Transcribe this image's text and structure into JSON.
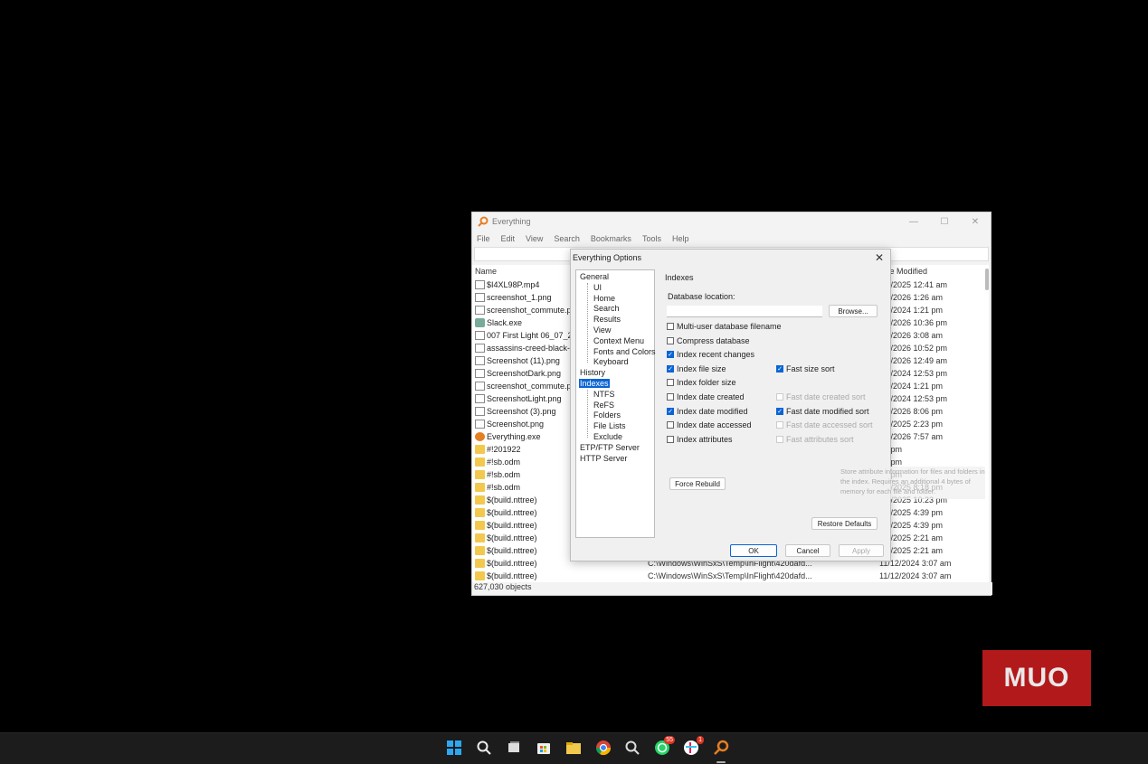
{
  "window": {
    "title": "Everything",
    "menu": [
      "File",
      "Edit",
      "View",
      "Search",
      "Bookmarks",
      "Tools",
      "Help"
    ],
    "columns": {
      "name": "Name",
      "date_modified": "te Modified"
    },
    "rows": [
      {
        "name": "$I4XL98P.mp4",
        "path": "",
        "date": "/02/2025 12:41 am",
        "icon": "file"
      },
      {
        "name": "screenshot_1.png",
        "path": "",
        "date": "/08/2026 1:26 am",
        "icon": "file"
      },
      {
        "name": "screenshot_commute.pn",
        "path": "",
        "date": "/04/2024 1:21 pm",
        "icon": "file"
      },
      {
        "name": "Slack.exe",
        "path": "",
        "date": "/07/2026 10:36 pm",
        "icon": "exe"
      },
      {
        "name": "007 First Light 06_07_202",
        "path": "",
        "date": "/07/2026 3:08 am",
        "icon": "file"
      },
      {
        "name": "assassins-creed-black-fl",
        "path": "",
        "date": "/03/2026 10:52 pm",
        "icon": "file"
      },
      {
        "name": "Screenshot (11).png",
        "path": "",
        "date": "/04/2026 12:49 am",
        "icon": "file"
      },
      {
        "name": "ScreenshotDark.png",
        "path": "",
        "date": "/10/2024 12:53 pm",
        "icon": "file"
      },
      {
        "name": "screenshot_commute.pn",
        "path": "",
        "date": "/04/2024 1:21 pm",
        "icon": "file"
      },
      {
        "name": "ScreenshotLight.png",
        "path": "",
        "date": "/10/2024 12:53 pm",
        "icon": "file"
      },
      {
        "name": "Screenshot (3).png",
        "path": "",
        "date": "/02/2026 8:06 pm",
        "icon": "file"
      },
      {
        "name": "Screenshot.png",
        "path": "",
        "date": "/05/2025 2:23 pm",
        "icon": "file"
      },
      {
        "name": "Everything.exe",
        "path": "",
        "date": "/01/2026 7:57 am",
        "icon": "ev"
      },
      {
        "name": "#!201922",
        "path": "",
        "date": "33 pm",
        "icon": "folder"
      },
      {
        "name": "#!sb.odm",
        "path": "",
        "date": "22 pm",
        "icon": "folder"
      },
      {
        "name": "#!sb.odm",
        "path": "",
        "date": "37 pm",
        "icon": "folder"
      },
      {
        "name": "#!sb.odm",
        "path": "",
        "date": "/05/2025 8:18 pm",
        "icon": "folder"
      },
      {
        "name": "$(build.nttree)",
        "path": "",
        "date": "/12/2025 10:23 pm",
        "icon": "folder"
      },
      {
        "name": "$(build.nttree)",
        "path": "",
        "date": "/06/2025 4:39 pm",
        "icon": "folder"
      },
      {
        "name": "$(build.nttree)",
        "path": "",
        "date": "/06/2025 4:39 pm",
        "icon": "folder"
      },
      {
        "name": "$(build.nttree)",
        "path": "",
        "date": "/05/2025 2:21 am",
        "icon": "folder"
      },
      {
        "name": "$(build.nttree)",
        "path": "",
        "date": "/05/2025 2:21 am",
        "icon": "folder"
      },
      {
        "name": "$(build.nttree)",
        "path": "C:\\Windows\\WinSxS\\Temp\\InFlight\\420dafd...",
        "date": "11/12/2024 3:07 am",
        "icon": "folder"
      },
      {
        "name": "$(build.nttree)",
        "path": "C:\\Windows\\WinSxS\\Temp\\InFlight\\420dafd...",
        "date": "11/12/2024 3:07 am",
        "icon": "folder"
      }
    ],
    "status": "627,030 objects"
  },
  "dialog": {
    "title": "Everything Options",
    "close": "✕",
    "tree": [
      {
        "label": "General",
        "level": 0
      },
      {
        "label": "UI",
        "level": 1
      },
      {
        "label": "Home",
        "level": 1
      },
      {
        "label": "Search",
        "level": 1
      },
      {
        "label": "Results",
        "level": 1
      },
      {
        "label": "View",
        "level": 1
      },
      {
        "label": "Context Menu",
        "level": 1
      },
      {
        "label": "Fonts and Colors",
        "level": 1
      },
      {
        "label": "Keyboard",
        "level": 1
      },
      {
        "label": "History",
        "level": 0
      },
      {
        "label": "Indexes",
        "level": 0,
        "selected": true
      },
      {
        "label": "NTFS",
        "level": 1
      },
      {
        "label": "ReFS",
        "level": 1
      },
      {
        "label": "Folders",
        "level": 1
      },
      {
        "label": "File Lists",
        "level": 1
      },
      {
        "label": "Exclude",
        "level": 1
      },
      {
        "label": "ETP/FTP Server",
        "level": 0
      },
      {
        "label": "HTTP Server",
        "level": 0
      }
    ],
    "panel": {
      "heading": "Indexes",
      "db_location_label": "Database location:",
      "db_location_value": "",
      "browse": "Browse...",
      "options_left": [
        {
          "label": "Multi-user database filename",
          "checked": false
        },
        {
          "label": "Compress database",
          "checked": false
        },
        {
          "label": "Index recent changes",
          "checked": true
        },
        {
          "label": "Index file size",
          "checked": true
        },
        {
          "label": "Index folder size",
          "checked": false
        },
        {
          "label": "Index date created",
          "checked": false
        },
        {
          "label": "Index date modified",
          "checked": true
        },
        {
          "label": "Index date accessed",
          "checked": false
        },
        {
          "label": "Index attributes",
          "checked": false
        }
      ],
      "options_right": [
        {
          "label": "Fast size sort",
          "checked": true,
          "disabled": false,
          "row": 3
        },
        {
          "label": "Fast date created sort",
          "checked": false,
          "disabled": true,
          "row": 5
        },
        {
          "label": "Fast date modified sort",
          "checked": true,
          "disabled": false,
          "row": 6
        },
        {
          "label": "Fast date accessed sort",
          "checked": false,
          "disabled": true,
          "row": 7
        },
        {
          "label": "Fast attributes sort",
          "checked": false,
          "disabled": true,
          "row": 8
        }
      ],
      "tooltip": "Store attribute information for files and folders in the index. Requires an additional 4 bytes of memory for each file and folder.",
      "force_rebuild": "Force Rebuild",
      "restore_defaults": "Restore Defaults"
    },
    "ok": "OK",
    "cancel": "Cancel",
    "apply": "Apply"
  },
  "taskbar": {
    "whatsapp_badge": "55",
    "app_badge": "1"
  },
  "watermark": "MUO"
}
